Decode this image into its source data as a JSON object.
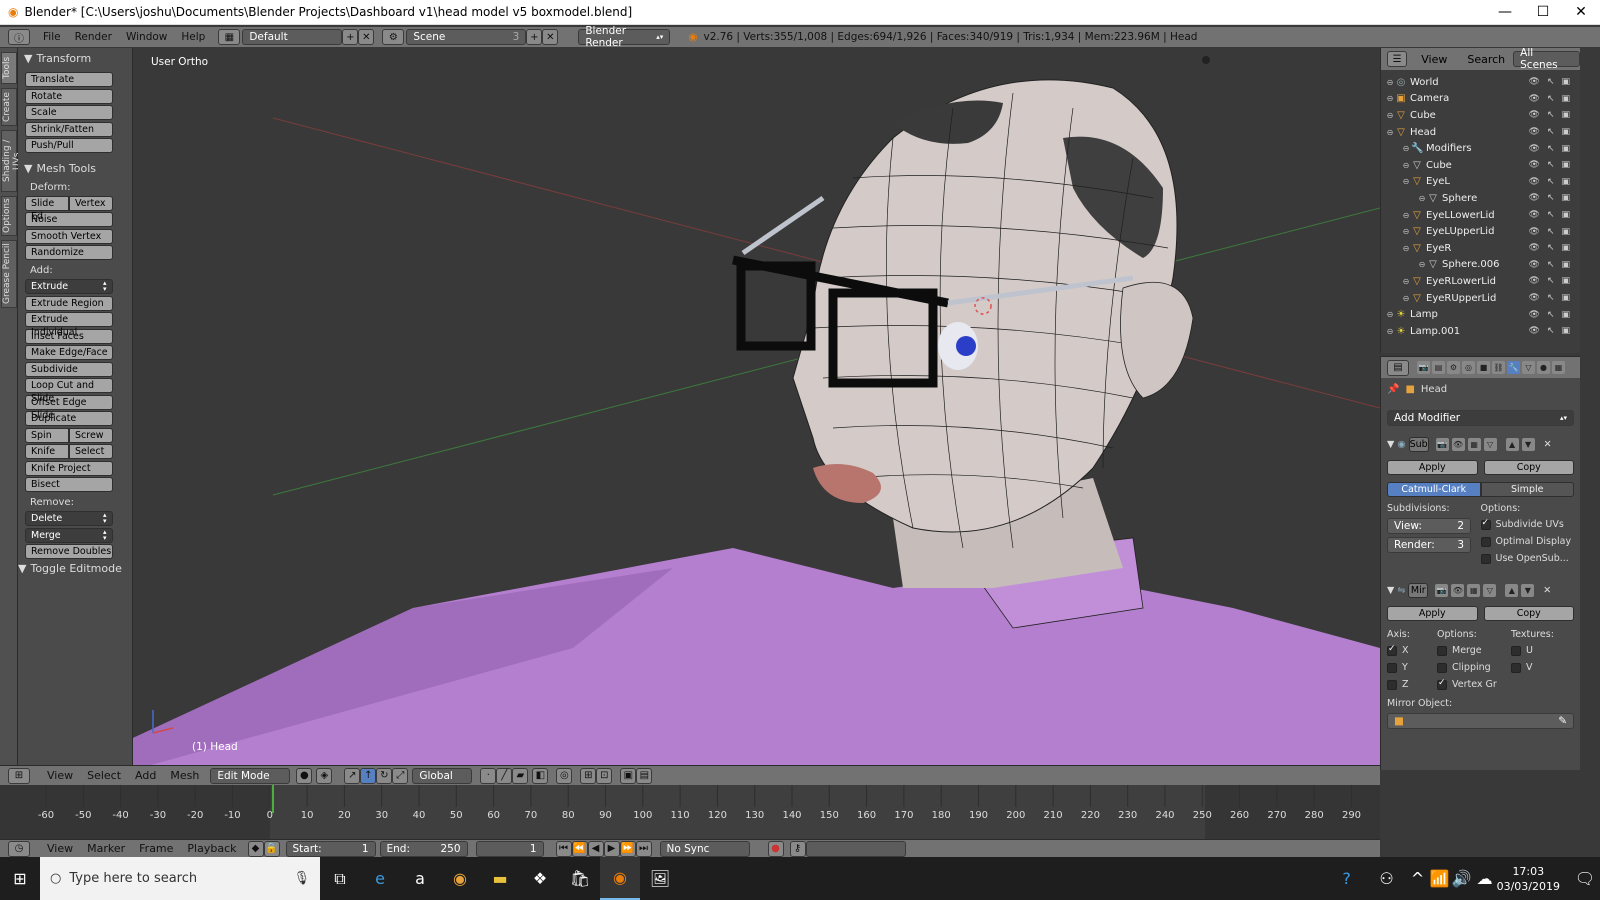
{
  "window": {
    "title": "Blender* [C:\\Users\\joshu\\Documents\\Blender Projects\\Dashboard v1\\head model v5 boxmodel.blend]",
    "minimize": "—",
    "maximize": "☐",
    "close": "✕"
  },
  "info": {
    "menus": [
      "File",
      "Render",
      "Window",
      "Help"
    ],
    "layout": "Default",
    "scene": "Scene",
    "scene_num": "3",
    "engine": "Blender Render",
    "stats": "v2.76 | Verts:355/1,008 | Edges:694/1,926 | Faces:340/919 | Tris:1,934 | Mem:223.96M | Head"
  },
  "tabs": [
    "Tools",
    "Create",
    "Shading / UVs",
    "Options",
    "Grease Pencil"
  ],
  "toolshelf": {
    "transform_title": "Transform",
    "transform": [
      "Translate",
      "Rotate",
      "Scale",
      "Shrink/Fatten",
      "Push/Pull"
    ],
    "mesh_tools_title": "Mesh Tools",
    "deform_label": "Deform:",
    "slide_edge": "Slide Ed",
    "vertex": "Vertex",
    "deform": [
      "Noise",
      "Smooth Vertex",
      "Randomize"
    ],
    "add_label": "Add:",
    "extrude": "Extrude",
    "add": [
      "Extrude Region",
      "Extrude Individual",
      "Inset Faces",
      "Make Edge/Face",
      "Subdivide",
      "Loop Cut and Slide",
      "Offset Edge Slide",
      "Duplicate"
    ],
    "spin": "Spin",
    "screw": "Screw",
    "knife": "Knife",
    "select": "Select",
    "knife_project": "Knife Project",
    "bisect": "Bisect",
    "remove_label": "Remove:",
    "delete": "Delete",
    "merge": "Merge",
    "remove_doubles": "Remove Doubles",
    "toggle_editmode": "Toggle Editmode"
  },
  "viewport": {
    "view_label": "User Ortho",
    "object_label": "(1) Head"
  },
  "view_header": {
    "menus": [
      "View",
      "Select",
      "Add",
      "Mesh"
    ],
    "mode": "Edit Mode",
    "orientation": "Global"
  },
  "timeline": {
    "ticks": [
      "-60",
      "-50",
      "-40",
      "-30",
      "-20",
      "-10",
      "0",
      "10",
      "20",
      "30",
      "40",
      "50",
      "60",
      "70",
      "80",
      "90",
      "100",
      "110",
      "120",
      "130",
      "140",
      "150",
      "160",
      "170",
      "180",
      "190",
      "200",
      "210",
      "220",
      "230",
      "240",
      "250",
      "260",
      "270",
      "280",
      "290"
    ],
    "menus": [
      "View",
      "Marker",
      "Frame",
      "Playback"
    ],
    "start_label": "Start:",
    "start": "1",
    "end_label": "End:",
    "end": "250",
    "current": "1",
    "sync": "No Sync"
  },
  "outliner": {
    "menus": [
      "View",
      "Search"
    ],
    "scope": "All Scenes",
    "items": [
      {
        "label": "World",
        "indent": 0,
        "icon": "world-icon",
        "glyph": "◎",
        "color": "#9aa"
      },
      {
        "label": "Camera",
        "indent": 0,
        "icon": "camera-icon",
        "glyph": "▣",
        "color": "#e6a23c"
      },
      {
        "label": "Cube",
        "indent": 0,
        "icon": "mesh-icon",
        "glyph": "▽",
        "color": "#e6a23c"
      },
      {
        "label": "Head",
        "indent": 0,
        "icon": "mesh-icon",
        "glyph": "▽",
        "color": "#e6a23c"
      },
      {
        "label": "Modifiers",
        "indent": 1,
        "icon": "wrench-icon",
        "glyph": "🔧",
        "color": "#8ab"
      },
      {
        "label": "Cube",
        "indent": 1,
        "icon": "mesh-data-icon",
        "glyph": "▽",
        "color": "#ccc"
      },
      {
        "label": "EyeL",
        "indent": 1,
        "icon": "mesh-icon",
        "glyph": "▽",
        "color": "#e6a23c"
      },
      {
        "label": "Sphere",
        "indent": 2,
        "icon": "mesh-data-icon",
        "glyph": "▽",
        "color": "#ccc"
      },
      {
        "label": "EyeLLowerLid",
        "indent": 1,
        "icon": "mesh-icon",
        "glyph": "▽",
        "color": "#e6a23c"
      },
      {
        "label": "EyeLUpperLid",
        "indent": 1,
        "icon": "mesh-icon",
        "glyph": "▽",
        "color": "#e6a23c"
      },
      {
        "label": "EyeR",
        "indent": 1,
        "icon": "mesh-icon",
        "glyph": "▽",
        "color": "#e6a23c"
      },
      {
        "label": "Sphere.006",
        "indent": 2,
        "icon": "mesh-data-icon",
        "glyph": "▽",
        "color": "#ccc"
      },
      {
        "label": "EyeRLowerLid",
        "indent": 1,
        "icon": "mesh-icon",
        "glyph": "▽",
        "color": "#e6a23c"
      },
      {
        "label": "EyeRUpperLid",
        "indent": 1,
        "icon": "mesh-icon",
        "glyph": "▽",
        "color": "#e6a23c"
      },
      {
        "label": "Lamp",
        "indent": 0,
        "icon": "lamp-icon",
        "glyph": "☀",
        "color": "#e6d23c"
      },
      {
        "label": "Lamp.001",
        "indent": 0,
        "icon": "lamp-icon",
        "glyph": "☀",
        "color": "#e6d23c"
      }
    ]
  },
  "properties": {
    "object": "Head",
    "add_modifier": "Add Modifier",
    "subsurf": {
      "name": "Sub",
      "apply": "Apply",
      "copy": "Copy",
      "catmull": "Catmull-Clark",
      "simple": "Simple",
      "subdivisions_label": "Subdivisions:",
      "options_label": "Options:",
      "view_label": "View:",
      "view": "2",
      "render_label": "Render:",
      "render": "3",
      "subdivide_uvs": "Subdivide UVs",
      "optimal_display": "Optimal Display",
      "use_opensub": "Use OpenSub..."
    },
    "mirror": {
      "name": "Mir",
      "apply": "Apply",
      "copy": "Copy",
      "axis_label": "Axis:",
      "options_label": "Options:",
      "textures_label": "Textures:",
      "x": "X",
      "y": "Y",
      "z": "Z",
      "merge": "Merge",
      "clipping": "Clipping",
      "vertex_gr": "Vertex Gr",
      "u": "U",
      "v": "V",
      "mirror_object_label": "Mirror Object:"
    }
  },
  "taskbar": {
    "search_placeholder": "Type here to search",
    "time": "17:03",
    "date": "03/03/2019"
  },
  "colors": {
    "accent": "#5680c2",
    "skin": "#cfc6c4",
    "body": "#b57fd0",
    "ui_bg": "#393939"
  }
}
